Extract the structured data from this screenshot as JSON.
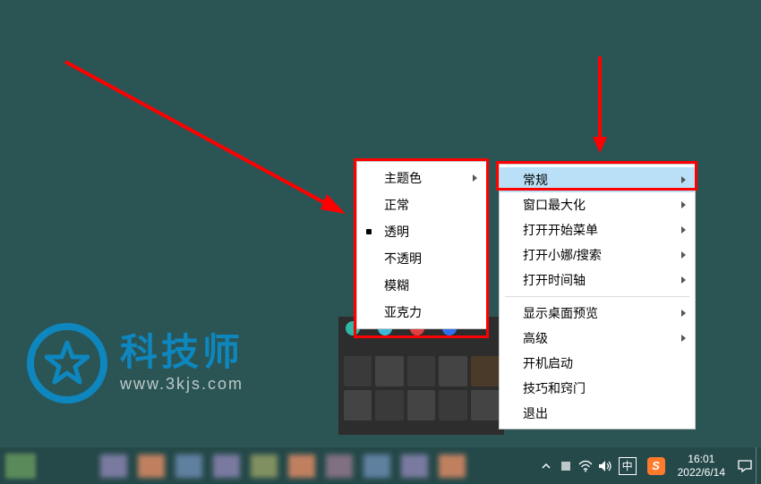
{
  "submenu": {
    "items": [
      {
        "label": "主题色",
        "selected": false,
        "arrow": true
      },
      {
        "label": "正常",
        "selected": false,
        "arrow": false
      },
      {
        "label": "透明",
        "selected": true,
        "arrow": false
      },
      {
        "label": "不透明",
        "selected": false,
        "arrow": false
      },
      {
        "label": "模糊",
        "selected": false,
        "arrow": false
      },
      {
        "label": "亚克力",
        "selected": false,
        "arrow": false
      }
    ]
  },
  "menu": {
    "items": [
      {
        "label": "常规",
        "arrow": true,
        "highlight": true
      },
      {
        "label": "窗口最大化",
        "arrow": true
      },
      {
        "label": "打开开始菜单",
        "arrow": true
      },
      {
        "label": "打开小娜/搜索",
        "arrow": true
      },
      {
        "label": "打开时间轴",
        "arrow": true
      },
      {
        "sep": true
      },
      {
        "label": "显示桌面预览",
        "arrow": true
      },
      {
        "label": "高级",
        "arrow": true
      },
      {
        "label": "开机启动"
      },
      {
        "label": "技巧和窍门"
      },
      {
        "label": "退出"
      }
    ]
  },
  "logo": {
    "title": "科技师",
    "url": "www.3kjs.com"
  },
  "tray": {
    "ime": "中",
    "sogou": "S",
    "time": "16:01",
    "date": "2022/6/14"
  }
}
